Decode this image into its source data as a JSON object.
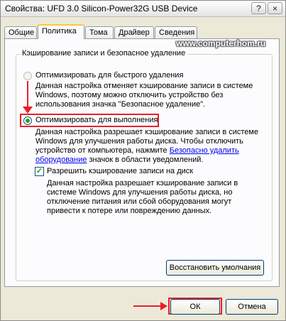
{
  "window": {
    "title": "Свойства: UFD 3.0 Silicon-Power32G USB Device",
    "help_glyph": "?",
    "close_glyph": "×"
  },
  "tabs": [
    {
      "label": "Общие"
    },
    {
      "label": "Политика"
    },
    {
      "label": "Тома"
    },
    {
      "label": "Драйвер"
    },
    {
      "label": "Сведения"
    }
  ],
  "watermark": "www.computerhom.ru",
  "group": {
    "legend": "Кэширование записи и безопасное удаление",
    "option_quick": {
      "label": "Оптимизировать для быстрого удаления",
      "description": "Данная настройка отменяет кэширование записи в системе Windows, поэтому можно отключить устройство без использования значка \"Безопасное удаление\"."
    },
    "option_perf": {
      "label": "Оптимизировать для выполнения",
      "description_part1": "Данная настройка разрешает кэширование записи в системе Windows для улучшения работы диска. Чтобы отключить устройство от компьютера, нажмите ",
      "description_link": "Безопасно удалить оборудование",
      "description_part2": " значок в области уведомлений."
    },
    "write_cache": {
      "label": "Разрешить кэширование записи на диск",
      "checked": true,
      "description": "Данная настройка разрешает кэширование записи в системе Windows для улучшения работы диска, но отключение питания или сбой оборудования могут привести к потере или повреждению данных."
    },
    "restore_button": "Восстановить умолчания"
  },
  "footer": {
    "ok": "ОК",
    "cancel": "Отмена"
  },
  "colors": {
    "highlight": "#e8202a",
    "accent_tab": "#ffc83c"
  }
}
